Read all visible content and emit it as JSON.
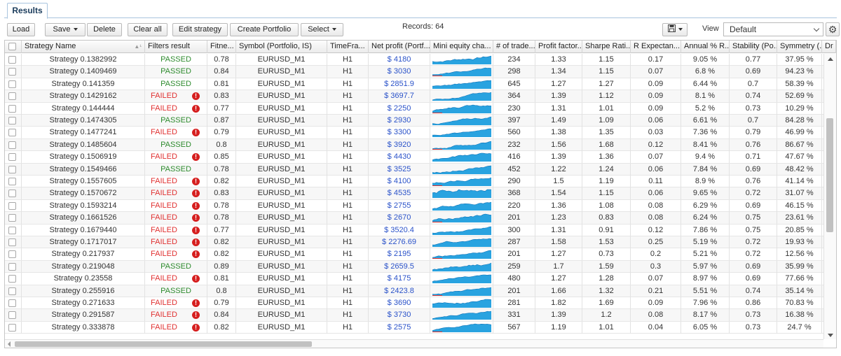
{
  "tab": {
    "label": "Results"
  },
  "toolbar": {
    "load": "Load",
    "save": "Save",
    "delete": "Delete",
    "clear_all": "Clear all",
    "edit_strategy": "Edit strategy",
    "create_portfolio": "Create Portfolio",
    "select": "Select",
    "records": "Records: 64",
    "view_label": "View",
    "view_value": "Default"
  },
  "columns": [
    "Strategy Name",
    "Filters result",
    "Fitne...",
    "Symbol (Portfolio, IS)",
    "TimeFra...",
    "Net profit (Portf...",
    "Mini equity cha...",
    "# of trade...",
    "Profit factor...",
    "Sharpe Rati...",
    "R Expectan...",
    "Annual % R...",
    "Stability (Po...",
    "Symmetry (...",
    "Dr"
  ],
  "sort_indicator": "▲¹",
  "rows": [
    [
      "Strategy 0.1382992",
      "PASSED",
      "0.78",
      "EURUSD_M1",
      "H1",
      "$ 4180",
      "234",
      "1.33",
      "1.15",
      "0.17",
      "9.05 %",
      "0.77",
      "37.95 %"
    ],
    [
      "Strategy 0.1409469",
      "PASSED",
      "0.84",
      "EURUSD_M1",
      "H1",
      "$ 3030",
      "298",
      "1.34",
      "1.15",
      "0.07",
      "6.8 %",
      "0.69",
      "94.23 %"
    ],
    [
      "Strategy 0.141359",
      "PASSED",
      "0.81",
      "EURUSD_M1",
      "H1",
      "$ 2851.9",
      "645",
      "1.27",
      "1.27",
      "0.09",
      "6.44 %",
      "0.7",
      "58.39 %"
    ],
    [
      "Strategy 0.1429162",
      "FAILED",
      "0.83",
      "EURUSD_M1",
      "H1",
      "$ 3697.7",
      "364",
      "1.39",
      "1.12",
      "0.09",
      "8.1 %",
      "0.74",
      "52.69 %"
    ],
    [
      "Strategy 0.144444",
      "FAILED",
      "0.77",
      "EURUSD_M1",
      "H1",
      "$ 2250",
      "230",
      "1.31",
      "1.01",
      "0.09",
      "5.2 %",
      "0.73",
      "10.29 %"
    ],
    [
      "Strategy 0.1474305",
      "PASSED",
      "0.87",
      "EURUSD_M1",
      "H1",
      "$ 2930",
      "397",
      "1.49",
      "1.09",
      "0.06",
      "6.61 %",
      "0.7",
      "84.28 %"
    ],
    [
      "Strategy 0.1477241",
      "FAILED",
      "0.79",
      "EURUSD_M1",
      "H1",
      "$ 3300",
      "560",
      "1.38",
      "1.35",
      "0.03",
      "7.36 %",
      "0.79",
      "46.99 %"
    ],
    [
      "Strategy 0.1485604",
      "PASSED",
      "0.8",
      "EURUSD_M1",
      "H1",
      "$ 3920",
      "232",
      "1.56",
      "1.68",
      "0.12",
      "8.41 %",
      "0.76",
      "86.67 %"
    ],
    [
      "Strategy 0.1506919",
      "FAILED",
      "0.85",
      "EURUSD_M1",
      "H1",
      "$ 4430",
      "416",
      "1.39",
      "1.36",
      "0.07",
      "9.4 %",
      "0.71",
      "47.67 %"
    ],
    [
      "Strategy 0.1549466",
      "PASSED",
      "0.78",
      "EURUSD_M1",
      "H1",
      "$ 3525",
      "452",
      "1.22",
      "1.24",
      "0.06",
      "7.84 %",
      "0.69",
      "48.42 %"
    ],
    [
      "Strategy 0.1557605",
      "FAILED",
      "0.82",
      "EURUSD_M1",
      "H1",
      "$ 4100",
      "290",
      "1.5",
      "1.19",
      "0.11",
      "8.9 %",
      "0.76",
      "41.14 %"
    ],
    [
      "Strategy 0.1570672",
      "FAILED",
      "0.83",
      "EURUSD_M1",
      "H1",
      "$ 4535",
      "368",
      "1.54",
      "1.15",
      "0.06",
      "9.65 %",
      "0.72",
      "31.07 %"
    ],
    [
      "Strategy 0.1593214",
      "FAILED",
      "0.78",
      "EURUSD_M1",
      "H1",
      "$ 2755",
      "220",
      "1.36",
      "1.08",
      "0.08",
      "6.29 %",
      "0.69",
      "46.15 %"
    ],
    [
      "Strategy 0.1661526",
      "FAILED",
      "0.78",
      "EURUSD_M1",
      "H1",
      "$ 2670",
      "201",
      "1.23",
      "0.83",
      "0.08",
      "6.24 %",
      "0.75",
      "23.61 %"
    ],
    [
      "Strategy 0.1679440",
      "FAILED",
      "0.77",
      "EURUSD_M1",
      "H1",
      "$ 3520.4",
      "300",
      "1.31",
      "0.91",
      "0.12",
      "7.86 %",
      "0.75",
      "20.85 %"
    ],
    [
      "Strategy 0.1717017",
      "FAILED",
      "0.82",
      "EURUSD_M1",
      "H1",
      "$ 2276.69",
      "287",
      "1.58",
      "1.53",
      "0.25",
      "5.19 %",
      "0.72",
      "19.93 %"
    ],
    [
      "Strategy 0.217937",
      "FAILED",
      "0.82",
      "EURUSD_M1",
      "H1",
      "$ 2195",
      "201",
      "1.27",
      "0.73",
      "0.2",
      "5.21 %",
      "0.72",
      "12.56 %"
    ],
    [
      "Strategy 0.219048",
      "PASSED",
      "0.89",
      "EURUSD_M1",
      "H1",
      "$ 2659.5",
      "259",
      "1.7",
      "1.59",
      "0.3",
      "5.97 %",
      "0.69",
      "35.99 %"
    ],
    [
      "Strategy 0.23558",
      "FAILED",
      "0.81",
      "EURUSD_M1",
      "H1",
      "$ 4175",
      "480",
      "1.27",
      "1.28",
      "0.07",
      "8.97 %",
      "0.69",
      "77.66 %"
    ],
    [
      "Strategy 0.255916",
      "PASSED",
      "0.8",
      "EURUSD_M1",
      "H1",
      "$ 2423.8",
      "201",
      "1.66",
      "1.32",
      "0.21",
      "5.51 %",
      "0.74",
      "35.14 %"
    ],
    [
      "Strategy 0.271633",
      "FAILED",
      "0.79",
      "EURUSD_M1",
      "H1",
      "$ 3690",
      "281",
      "1.82",
      "1.69",
      "0.09",
      "7.96 %",
      "0.86",
      "70.83 %"
    ],
    [
      "Strategy 0.291587",
      "FAILED",
      "0.84",
      "EURUSD_M1",
      "H1",
      "$ 3730",
      "331",
      "1.39",
      "1.2",
      "0.08",
      "8.17 %",
      "0.73",
      "16.38 %"
    ],
    [
      "Strategy 0.333878",
      "FAILED",
      "0.82",
      "EURUSD_M1",
      "H1",
      "$ 2575",
      "567",
      "1.19",
      "1.01",
      "0.04",
      "6.05 %",
      "0.73",
      "24.7 %"
    ]
  ],
  "colors": {
    "passed": "#2e8b2e",
    "failed": "#e03030",
    "net_profit": "#2a52c9",
    "equity_fill": "#29a3e0",
    "equity_drawdown": "#d93030"
  },
  "icons": {
    "error": "error-icon",
    "save_disk": "save-icon",
    "settings": "gear-icon"
  }
}
